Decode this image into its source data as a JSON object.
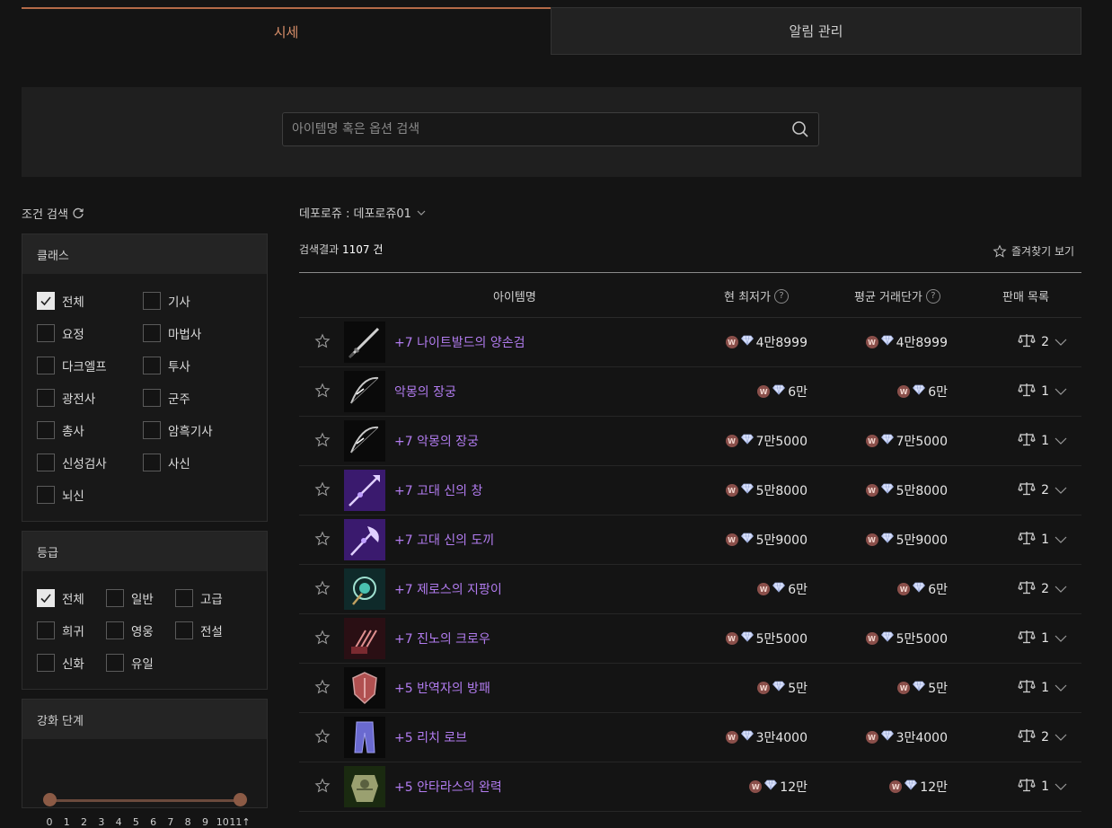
{
  "tabs": [
    {
      "label": "시세",
      "active": true
    },
    {
      "label": "알림 관리",
      "active": false
    }
  ],
  "search": {
    "placeholder": "아이템명 혹은 옵션 검색"
  },
  "filter": {
    "title": "조건 검색",
    "class_panel": {
      "title": "클래스",
      "items": [
        {
          "label": "전체",
          "checked": true
        },
        {
          "label": "기사",
          "checked": false
        },
        {
          "label": "요정",
          "checked": false
        },
        {
          "label": "마법사",
          "checked": false
        },
        {
          "label": "다크엘프",
          "checked": false
        },
        {
          "label": "투사",
          "checked": false
        },
        {
          "label": "광전사",
          "checked": false
        },
        {
          "label": "군주",
          "checked": false
        },
        {
          "label": "총사",
          "checked": false
        },
        {
          "label": "암흑기사",
          "checked": false
        },
        {
          "label": "신성검사",
          "checked": false
        },
        {
          "label": "사신",
          "checked": false
        },
        {
          "label": "뇌신",
          "checked": false
        }
      ]
    },
    "grade_panel": {
      "title": "등급",
      "items": [
        {
          "label": "전체",
          "checked": true
        },
        {
          "label": "일반",
          "checked": false
        },
        {
          "label": "고급",
          "checked": false
        },
        {
          "label": "희귀",
          "checked": false
        },
        {
          "label": "영웅",
          "checked": false
        },
        {
          "label": "전설",
          "checked": false
        },
        {
          "label": "신화",
          "checked": false
        },
        {
          "label": "유일",
          "checked": false
        }
      ]
    },
    "enhance_panel": {
      "title": "강화 단계",
      "ticks": [
        "0",
        "1",
        "2",
        "3",
        "4",
        "5",
        "6",
        "7",
        "8",
        "9",
        "10",
        "11↑"
      ],
      "range": [
        0,
        11
      ]
    }
  },
  "server": {
    "label": "데포로쥬 : 데포로쥬01"
  },
  "results": {
    "prefix": "검색결과",
    "count": "1107",
    "suffix": "건"
  },
  "favorites_label": "즐겨찾기 보기",
  "table": {
    "headers": {
      "name": "아이템명",
      "current": "현 최저가",
      "avg": "평균 거래단가",
      "sales": "판매 목록"
    },
    "rows": [
      {
        "name": "+7 나이트발드의 양손검",
        "current": "4만8999",
        "avg": "4만8999",
        "count": "2",
        "icon": "sword-icon",
        "bg": "#0a0a0a",
        "accent": "#d0d0d0"
      },
      {
        "name": "악몽의 장궁",
        "current": "6만",
        "avg": "6만",
        "count": "1",
        "icon": "bow-icon",
        "bg": "#0a0a0a",
        "accent": "#c8c8c8"
      },
      {
        "name": "+7 악몽의 장궁",
        "current": "7만5000",
        "avg": "7만5000",
        "count": "1",
        "icon": "bow-icon",
        "bg": "#0a0a0a",
        "accent": "#c8c8c8"
      },
      {
        "name": "+7 고대 신의 창",
        "current": "5만8000",
        "avg": "5만8000",
        "count": "2",
        "icon": "spear-icon",
        "bg": "#3a1a6e",
        "accent": "#e0d0ff"
      },
      {
        "name": "+7 고대 신의 도끼",
        "current": "5만9000",
        "avg": "5만9000",
        "count": "1",
        "icon": "axe-icon",
        "bg": "#3a1a6e",
        "accent": "#e0d0ff"
      },
      {
        "name": "+7 제로스의 지팡이",
        "current": "6만",
        "avg": "6만",
        "count": "2",
        "icon": "staff-icon",
        "bg": "#0f2a2a",
        "accent": "#9fe0d0"
      },
      {
        "name": "+7 진노의 크로우",
        "current": "5만5000",
        "avg": "5만5000",
        "count": "1",
        "icon": "claw-icon",
        "bg": "#2a0f14",
        "accent": "#e09090"
      },
      {
        "name": "+5 반역자의 방패",
        "current": "5만",
        "avg": "5만",
        "count": "1",
        "icon": "shield-icon",
        "bg": "#0a0a0a",
        "accent": "#b05050"
      },
      {
        "name": "+5 리치 로브",
        "current": "3만4000",
        "avg": "3만4000",
        "count": "2",
        "icon": "robe-icon",
        "bg": "#0a0a0a",
        "accent": "#6a6ad0"
      },
      {
        "name": "+5 안타라스의 완력",
        "current": "12만",
        "avg": "12만",
        "count": "1",
        "icon": "armor-icon",
        "bg": "#1a2a10",
        "accent": "#9aa070"
      }
    ]
  },
  "colors": {
    "accent": "#d98f6a",
    "item_name": "#b27cf0",
    "coin": "#8a4f4a"
  }
}
